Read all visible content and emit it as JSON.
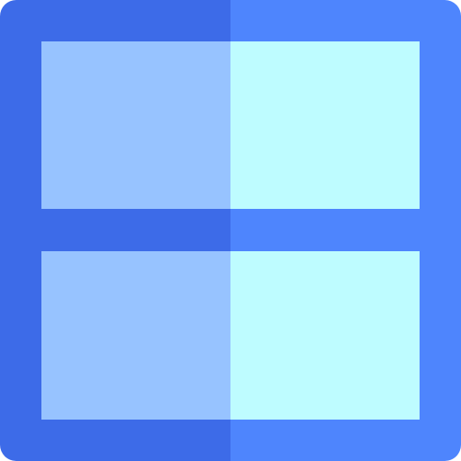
{
  "icon": {
    "name": "window-grid-icon",
    "colors": {
      "frame_left": "#3D6BE8",
      "frame_right": "#4E85FD",
      "pane_left": "#97C3FF",
      "pane_right": "#BEFCFF"
    }
  }
}
